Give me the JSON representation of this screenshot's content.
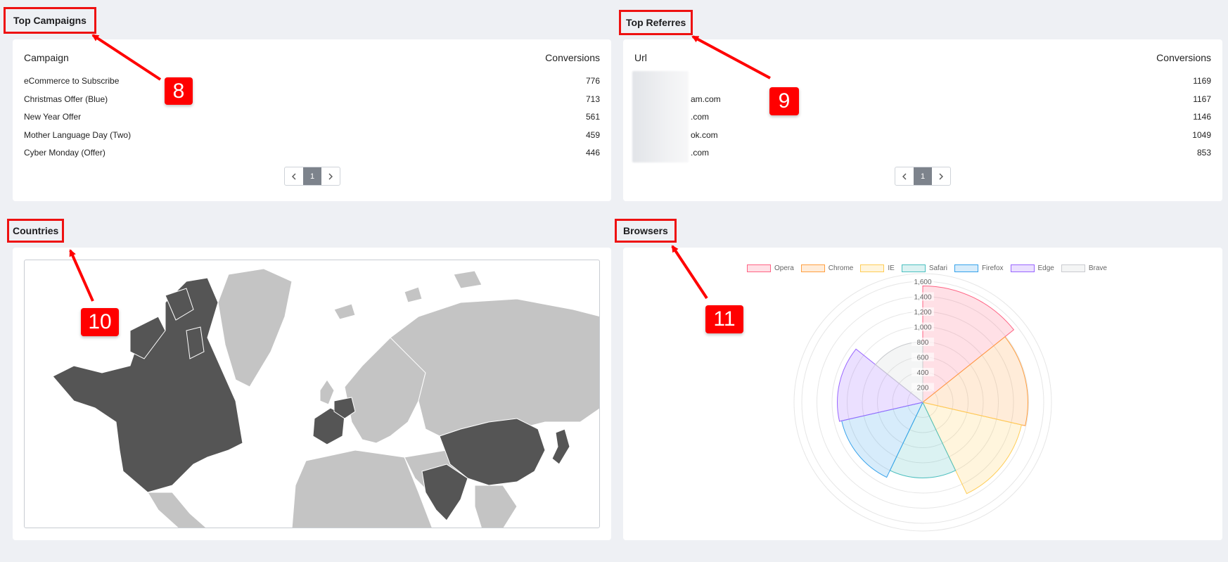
{
  "campaigns": {
    "title": "Top Campaigns",
    "col1": "Campaign",
    "col2": "Conversions",
    "rows": [
      {
        "name": "eCommerce to Subscribe",
        "value": "776"
      },
      {
        "name": "Christmas Offer (Blue)",
        "value": "713"
      },
      {
        "name": "New Year Offer",
        "value": "561"
      },
      {
        "name": "Mother Language Day (Two)",
        "value": "459"
      },
      {
        "name": "Cyber Monday (Offer)",
        "value": "446"
      }
    ],
    "page": "1"
  },
  "referrers": {
    "title": "Top Referres",
    "col1": "Url",
    "col2": "Conversions",
    "rows": [
      {
        "url": "",
        "value": "1169"
      },
      {
        "url": "am.com",
        "value": "1167"
      },
      {
        "url": ".com",
        "value": "1146"
      },
      {
        "url": "ok.com",
        "value": "1049"
      },
      {
        "url": ".com",
        "value": "853"
      }
    ],
    "page": "1"
  },
  "countries": {
    "title": "Countries"
  },
  "browsers": {
    "title": "Browsers"
  },
  "annotations": {
    "a8": "8",
    "a9": "9",
    "a10": "10",
    "a11": "11"
  },
  "pager_icons": {
    "prev": "chevron-left-icon",
    "next": "chevron-right-icon"
  },
  "colors": {
    "highlight": "#ee1111",
    "badge": "#ff0000",
    "map_land": "#c4c4c4",
    "map_highlight": "#555555"
  },
  "chart_data": {
    "type": "polar-area",
    "legend": [
      "Opera",
      "Chrome",
      "IE",
      "Safari",
      "Firefox",
      "Edge",
      "Brave"
    ],
    "legend_position": "top",
    "values": [
      1540,
      1390,
      1340,
      1000,
      1100,
      1130,
      800
    ],
    "colors": [
      "#ff6384",
      "#ff9f40",
      "#ffcd56",
      "#4bc0c0",
      "#36a2eb",
      "#9966ff",
      "#c9cbcf"
    ],
    "r_ticks": [
      "200",
      "400",
      "600",
      "800",
      "1,000",
      "1,200",
      "1,400",
      "1,600"
    ],
    "rlim": [
      0,
      1600
    ]
  }
}
